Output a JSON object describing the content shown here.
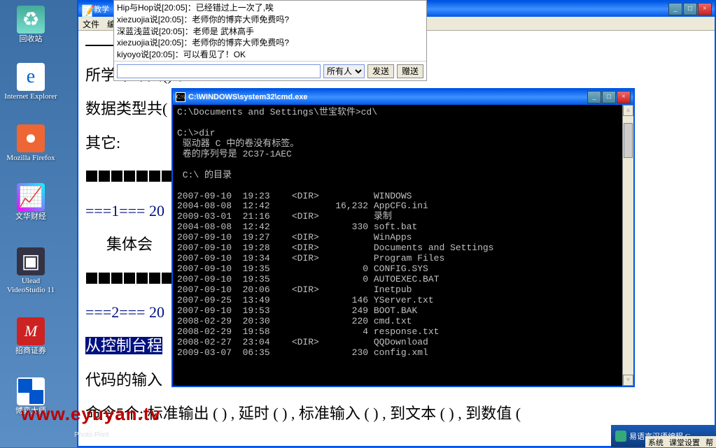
{
  "desktop": {
    "icons": [
      {
        "name": "recycle-bin",
        "label": "回收站",
        "cls": "recycle",
        "glyph": "♻"
      },
      {
        "name": "internet-explorer",
        "label": "Internet Explorer",
        "cls": "ie",
        "glyph": "e"
      },
      {
        "name": "firefox",
        "label": "Mozilla Firefox",
        "cls": "ff",
        "glyph": "●"
      },
      {
        "name": "wenhua",
        "label": "文华财经",
        "cls": "wh",
        "glyph": "📈"
      },
      {
        "name": "ulead",
        "label": "Ulead VideoStudio 11",
        "cls": "uv",
        "glyph": "▣"
      },
      {
        "name": "zhaoshang",
        "label": "招商证券",
        "cls": "zs",
        "glyph": "M"
      },
      {
        "name": "boyi",
        "label": "博弈大师",
        "cls": "by",
        "glyph": ""
      }
    ]
  },
  "doc": {
    "title": "教学",
    "menu": {
      "file": "文件",
      "edit": "编"
    },
    "lines": {
      "l1": "所学命令共()个:",
      "l2": "数据类型共(",
      "l3": "其它:",
      "l4a": "===1=== 20",
      "l4b": "集体会",
      "l5a": "===2=== 20",
      "l6": "从控制台程",
      "l7": "代码的输入",
      "l8": "命令5个: 标准输出 ( ) , 延时 ( ) , 标准输入 ( ) , 到文本 ( ) , 到数值 ("
    }
  },
  "chat": {
    "lines": [
      {
        "who": "Hip与Hop说",
        "time": "[20:05]",
        "msg": "：已经错过上一次了,唉"
      },
      {
        "who": "xiezuojia说",
        "time": "[20:05]",
        "msg": "：老师你的博弈大师免费吗?"
      },
      {
        "who": "深蓝浅蓝说",
        "time": "[20:05]",
        "msg": "：老师是 武林高手"
      },
      {
        "who": "xiezuojia说",
        "time": "[20:05]",
        "msg": "：老师你的博弈大师免费吗?"
      },
      {
        "who": "kiyoyo说",
        "time": "[20:05]",
        "msg": "：可以看见了！OK"
      }
    ],
    "input_value": "",
    "target": "所有人",
    "send": "发送",
    "gift": "赠送"
  },
  "cmd": {
    "title": "C:\\WINDOWS\\system32\\cmd.exe",
    "lines": [
      "C:\\Documents and Settings\\世宝软件>cd\\",
      "",
      "C:\\>dir",
      " 驱动器 C 中的卷没有标签。",
      " 卷的序列号是 2C37-1AEC",
      "",
      " C:\\ 的目录",
      "",
      "2007-09-10  19:23    <DIR>          WINDOWS",
      "2004-08-08  12:42            16,232 AppCFG.ini",
      "2009-03-01  21:16    <DIR>          录制",
      "2004-08-08  12:42               330 soft.bat",
      "2007-09-10  19:27    <DIR>          WinApps",
      "2007-09-10  19:28    <DIR>          Documents and Settings",
      "2007-09-10  19:34    <DIR>          Program Files",
      "2007-09-10  19:35                 0 CONFIG.SYS",
      "2007-09-10  19:35                 0 AUTOEXEC.BAT",
      "2007-09-10  20:06    <DIR>          Inetpub",
      "2007-09-25  13:49               146 YServer.txt",
      "2007-09-10  19:53               249 BOOT.BAK",
      "2008-02-29  20:30               220 cmd.txt",
      "2008-02-29  19:58                 4 response.txt",
      "2008-02-27  23:04    <DIR>          QQDownload",
      "2009-03-07  06:35               230 config.xml"
    ]
  },
  "watermark": "www.eyuyan.tv",
  "photo_label": "Photo Print",
  "taskbar": {
    "app_title": "易语言汉语编程 C",
    "menus": [
      "系统",
      "课堂设置",
      "帮"
    ]
  },
  "winbtns": {
    "min": "_",
    "max": "□",
    "close": "×"
  }
}
